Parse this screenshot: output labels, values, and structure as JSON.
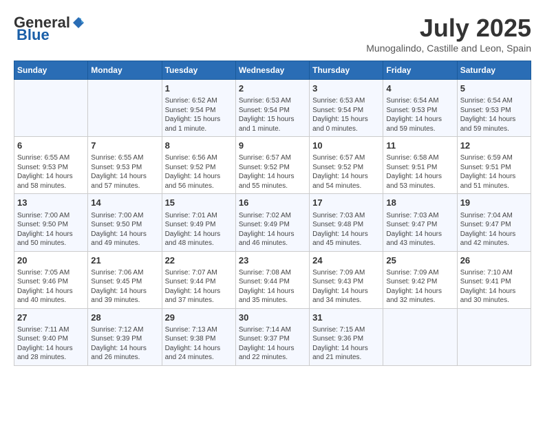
{
  "header": {
    "logo_general": "General",
    "logo_blue": "Blue",
    "month_title": "July 2025",
    "location": "Munogalindo, Castille and Leon, Spain"
  },
  "days_of_week": [
    "Sunday",
    "Monday",
    "Tuesday",
    "Wednesday",
    "Thursday",
    "Friday",
    "Saturday"
  ],
  "weeks": [
    [
      {
        "day": "",
        "sunrise": "",
        "sunset": "",
        "daylight": ""
      },
      {
        "day": "",
        "sunrise": "",
        "sunset": "",
        "daylight": ""
      },
      {
        "day": "1",
        "sunrise": "Sunrise: 6:52 AM",
        "sunset": "Sunset: 9:54 PM",
        "daylight": "Daylight: 15 hours and 1 minute."
      },
      {
        "day": "2",
        "sunrise": "Sunrise: 6:53 AM",
        "sunset": "Sunset: 9:54 PM",
        "daylight": "Daylight: 15 hours and 1 minute."
      },
      {
        "day": "3",
        "sunrise": "Sunrise: 6:53 AM",
        "sunset": "Sunset: 9:54 PM",
        "daylight": "Daylight: 15 hours and 0 minutes."
      },
      {
        "day": "4",
        "sunrise": "Sunrise: 6:54 AM",
        "sunset": "Sunset: 9:53 PM",
        "daylight": "Daylight: 14 hours and 59 minutes."
      },
      {
        "day": "5",
        "sunrise": "Sunrise: 6:54 AM",
        "sunset": "Sunset: 9:53 PM",
        "daylight": "Daylight: 14 hours and 59 minutes."
      }
    ],
    [
      {
        "day": "6",
        "sunrise": "Sunrise: 6:55 AM",
        "sunset": "Sunset: 9:53 PM",
        "daylight": "Daylight: 14 hours and 58 minutes."
      },
      {
        "day": "7",
        "sunrise": "Sunrise: 6:55 AM",
        "sunset": "Sunset: 9:53 PM",
        "daylight": "Daylight: 14 hours and 57 minutes."
      },
      {
        "day": "8",
        "sunrise": "Sunrise: 6:56 AM",
        "sunset": "Sunset: 9:52 PM",
        "daylight": "Daylight: 14 hours and 56 minutes."
      },
      {
        "day": "9",
        "sunrise": "Sunrise: 6:57 AM",
        "sunset": "Sunset: 9:52 PM",
        "daylight": "Daylight: 14 hours and 55 minutes."
      },
      {
        "day": "10",
        "sunrise": "Sunrise: 6:57 AM",
        "sunset": "Sunset: 9:52 PM",
        "daylight": "Daylight: 14 hours and 54 minutes."
      },
      {
        "day": "11",
        "sunrise": "Sunrise: 6:58 AM",
        "sunset": "Sunset: 9:51 PM",
        "daylight": "Daylight: 14 hours and 53 minutes."
      },
      {
        "day": "12",
        "sunrise": "Sunrise: 6:59 AM",
        "sunset": "Sunset: 9:51 PM",
        "daylight": "Daylight: 14 hours and 51 minutes."
      }
    ],
    [
      {
        "day": "13",
        "sunrise": "Sunrise: 7:00 AM",
        "sunset": "Sunset: 9:50 PM",
        "daylight": "Daylight: 14 hours and 50 minutes."
      },
      {
        "day": "14",
        "sunrise": "Sunrise: 7:00 AM",
        "sunset": "Sunset: 9:50 PM",
        "daylight": "Daylight: 14 hours and 49 minutes."
      },
      {
        "day": "15",
        "sunrise": "Sunrise: 7:01 AM",
        "sunset": "Sunset: 9:49 PM",
        "daylight": "Daylight: 14 hours and 48 minutes."
      },
      {
        "day": "16",
        "sunrise": "Sunrise: 7:02 AM",
        "sunset": "Sunset: 9:49 PM",
        "daylight": "Daylight: 14 hours and 46 minutes."
      },
      {
        "day": "17",
        "sunrise": "Sunrise: 7:03 AM",
        "sunset": "Sunset: 9:48 PM",
        "daylight": "Daylight: 14 hours and 45 minutes."
      },
      {
        "day": "18",
        "sunrise": "Sunrise: 7:03 AM",
        "sunset": "Sunset: 9:47 PM",
        "daylight": "Daylight: 14 hours and 43 minutes."
      },
      {
        "day": "19",
        "sunrise": "Sunrise: 7:04 AM",
        "sunset": "Sunset: 9:47 PM",
        "daylight": "Daylight: 14 hours and 42 minutes."
      }
    ],
    [
      {
        "day": "20",
        "sunrise": "Sunrise: 7:05 AM",
        "sunset": "Sunset: 9:46 PM",
        "daylight": "Daylight: 14 hours and 40 minutes."
      },
      {
        "day": "21",
        "sunrise": "Sunrise: 7:06 AM",
        "sunset": "Sunset: 9:45 PM",
        "daylight": "Daylight: 14 hours and 39 minutes."
      },
      {
        "day": "22",
        "sunrise": "Sunrise: 7:07 AM",
        "sunset": "Sunset: 9:44 PM",
        "daylight": "Daylight: 14 hours and 37 minutes."
      },
      {
        "day": "23",
        "sunrise": "Sunrise: 7:08 AM",
        "sunset": "Sunset: 9:44 PM",
        "daylight": "Daylight: 14 hours and 35 minutes."
      },
      {
        "day": "24",
        "sunrise": "Sunrise: 7:09 AM",
        "sunset": "Sunset: 9:43 PM",
        "daylight": "Daylight: 14 hours and 34 minutes."
      },
      {
        "day": "25",
        "sunrise": "Sunrise: 7:09 AM",
        "sunset": "Sunset: 9:42 PM",
        "daylight": "Daylight: 14 hours and 32 minutes."
      },
      {
        "day": "26",
        "sunrise": "Sunrise: 7:10 AM",
        "sunset": "Sunset: 9:41 PM",
        "daylight": "Daylight: 14 hours and 30 minutes."
      }
    ],
    [
      {
        "day": "27",
        "sunrise": "Sunrise: 7:11 AM",
        "sunset": "Sunset: 9:40 PM",
        "daylight": "Daylight: 14 hours and 28 minutes."
      },
      {
        "day": "28",
        "sunrise": "Sunrise: 7:12 AM",
        "sunset": "Sunset: 9:39 PM",
        "daylight": "Daylight: 14 hours and 26 minutes."
      },
      {
        "day": "29",
        "sunrise": "Sunrise: 7:13 AM",
        "sunset": "Sunset: 9:38 PM",
        "daylight": "Daylight: 14 hours and 24 minutes."
      },
      {
        "day": "30",
        "sunrise": "Sunrise: 7:14 AM",
        "sunset": "Sunset: 9:37 PM",
        "daylight": "Daylight: 14 hours and 22 minutes."
      },
      {
        "day": "31",
        "sunrise": "Sunrise: 7:15 AM",
        "sunset": "Sunset: 9:36 PM",
        "daylight": "Daylight: 14 hours and 21 minutes."
      },
      {
        "day": "",
        "sunrise": "",
        "sunset": "",
        "daylight": ""
      },
      {
        "day": "",
        "sunrise": "",
        "sunset": "",
        "daylight": ""
      }
    ]
  ]
}
